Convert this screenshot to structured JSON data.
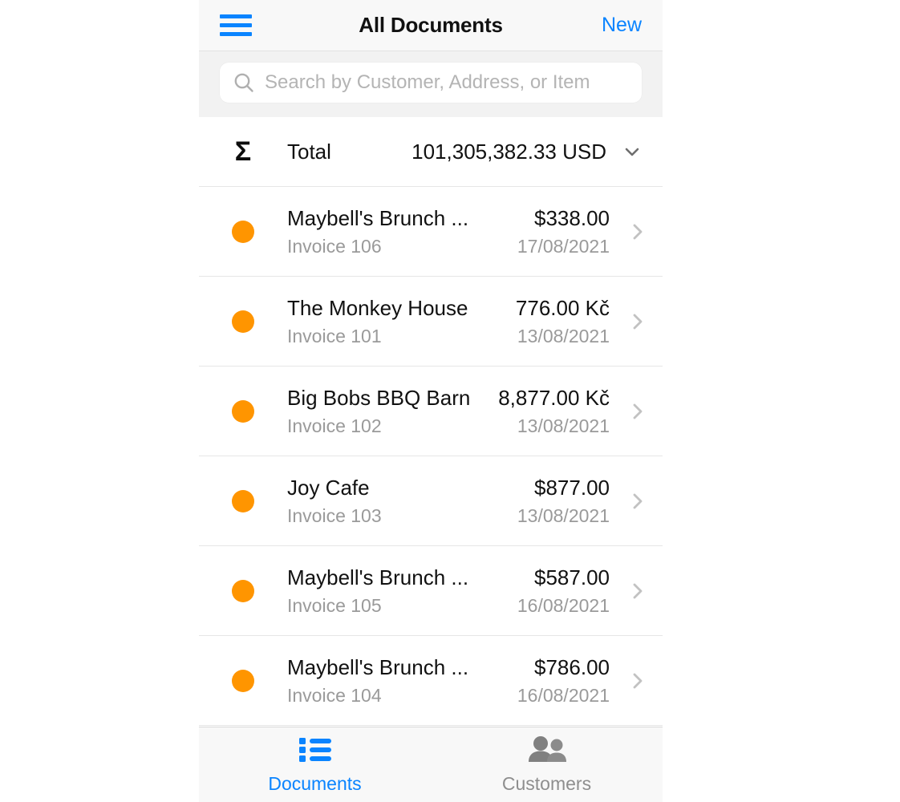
{
  "app": {
    "navbar": {
      "menu_icon": "hamburger-menu-icon",
      "title": "All Documents",
      "new_label": "New"
    },
    "search": {
      "icon": "search-icon",
      "placeholder": "Search by Customer, Address, or Item",
      "value": ""
    },
    "total": {
      "icon": "sigma-icon",
      "symbol": "Σ",
      "label": "Total",
      "amount": "101,305,382.33 USD",
      "chevron_icon": "chevron-down-icon"
    },
    "documents": [
      {
        "status": "open",
        "status_color": "#ff9500",
        "customer": "Maybell's Brunch ...",
        "reference": "Invoice 106",
        "amount": "$338.00",
        "date": "17/08/2021"
      },
      {
        "status": "open",
        "status_color": "#ff9500",
        "customer": "The Monkey House",
        "reference": "Invoice 101",
        "amount": "776.00 Kč",
        "date": "13/08/2021"
      },
      {
        "status": "open",
        "status_color": "#ff9500",
        "customer": "Big Bobs BBQ Barn",
        "reference": "Invoice 102",
        "amount": "8,877.00 Kč",
        "date": "13/08/2021"
      },
      {
        "status": "open",
        "status_color": "#ff9500",
        "customer": "Joy Cafe",
        "reference": "Invoice 103",
        "amount": "$877.00",
        "date": "13/08/2021"
      },
      {
        "status": "open",
        "status_color": "#ff9500",
        "customer": "Maybell's Brunch ...",
        "reference": "Invoice 105",
        "amount": "$587.00",
        "date": "16/08/2021"
      },
      {
        "status": "open",
        "status_color": "#ff9500",
        "customer": "Maybell's Brunch ...",
        "reference": "Invoice 104",
        "amount": "$786.00",
        "date": "16/08/2021"
      }
    ],
    "tabbar": {
      "tabs": [
        {
          "label": "Documents",
          "icon": "list-icon",
          "active": true
        },
        {
          "label": "Customers",
          "icon": "people-icon",
          "active": false
        }
      ]
    },
    "cursor": {
      "icon": "click-cursor-icon",
      "color": "#eda03a"
    },
    "colors": {
      "accent_blue": "#0a84ff",
      "status_orange": "#ff9500",
      "muted_gray": "#9a9a9a",
      "bar_gray": "#f2f2f2"
    }
  }
}
